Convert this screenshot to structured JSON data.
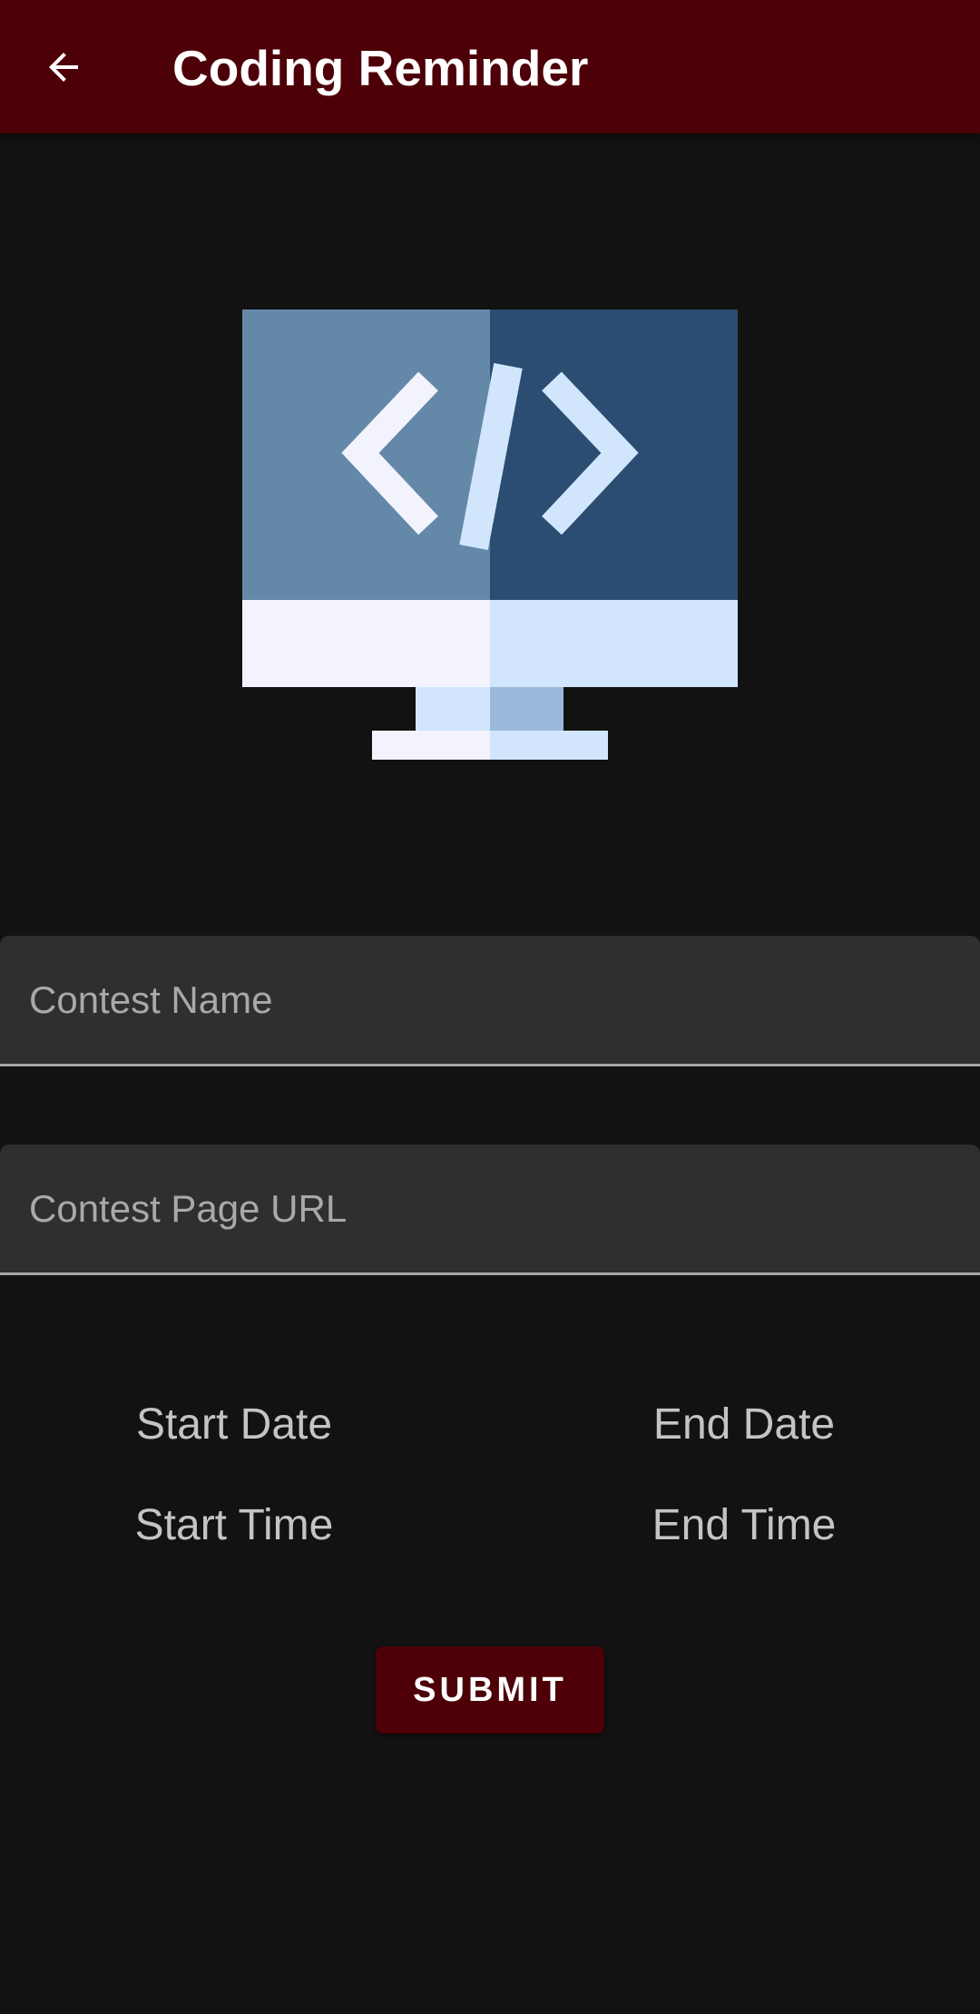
{
  "toolbar": {
    "title": "Coding Reminder",
    "back_icon": "arrow-left-icon",
    "background_color": "#4d0007"
  },
  "logo": {
    "icon": "computer-code-icon"
  },
  "form": {
    "contest_name_placeholder": "Contest Name",
    "contest_url_placeholder": "Contest Page URL",
    "start_date_label": "Start Date",
    "end_date_label": "End Date",
    "start_time_label": "Start Time",
    "end_time_label": "End Time",
    "submit_label": "SUBMIT"
  }
}
